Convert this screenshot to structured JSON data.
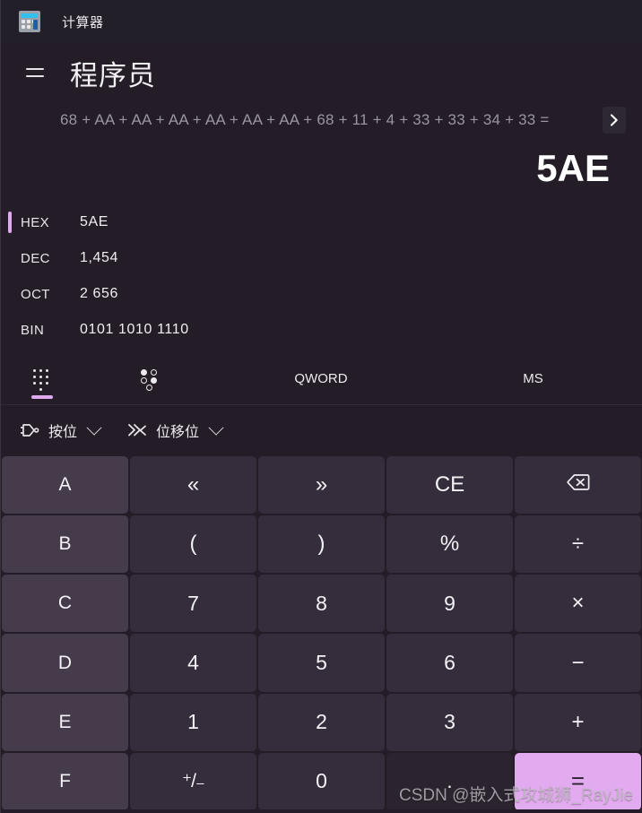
{
  "window": {
    "app_name": "计算器",
    "app_icon": "calculator-icon"
  },
  "header": {
    "menu_icon": "hamburger-menu-icon",
    "mode_title": "程序员"
  },
  "display": {
    "expression": "68 + AA + AA + AA + AA + AA + AA + 68 + 11 + 4 + 33 + 33 + 34 + 33 =",
    "scroll_right_icon": "chevron-right-icon",
    "result": "5AE"
  },
  "radix": {
    "active": "HEX",
    "rows": [
      {
        "label": "HEX",
        "value": "5AE"
      },
      {
        "label": "DEC",
        "value": "1,454"
      },
      {
        "label": "OCT",
        "value": "2 656"
      },
      {
        "label": "BIN",
        "value": "0101 1010 1110"
      }
    ]
  },
  "tabs": [
    {
      "label": "",
      "icon": "keypad-dots-icon",
      "active": true
    },
    {
      "label": "",
      "icon": "bit-toggle-icon",
      "active": false
    },
    {
      "label": "QWORD",
      "icon": "",
      "active": false
    },
    {
      "label": "MS",
      "icon": "",
      "active": false
    }
  ],
  "functions": [
    {
      "label": "按位",
      "icon": "logic-gate-icon",
      "chevron": "chevron-down-icon"
    },
    {
      "label": "位移位",
      "icon": "bit-shift-icon",
      "chevron": "chevron-down-icon"
    }
  ],
  "keypad": {
    "keys": [
      {
        "label": "A",
        "name": "key-a",
        "style": "hexkey"
      },
      {
        "label": "«",
        "name": "key-shift-left",
        "style": "op"
      },
      {
        "label": "»",
        "name": "key-shift-right",
        "style": "op"
      },
      {
        "label": "CE",
        "name": "key-clear-entry",
        "style": "op"
      },
      {
        "label": "",
        "name": "key-backspace",
        "style": "op",
        "icon": "backspace-icon"
      },
      {
        "label": "B",
        "name": "key-b",
        "style": "hexkey"
      },
      {
        "label": "(",
        "name": "key-paren-open",
        "style": "op"
      },
      {
        "label": ")",
        "name": "key-paren-close",
        "style": "op"
      },
      {
        "label": "%",
        "name": "key-percent",
        "style": "op"
      },
      {
        "label": "÷",
        "name": "key-divide",
        "style": "op"
      },
      {
        "label": "C",
        "name": "key-c",
        "style": "hexkey"
      },
      {
        "label": "7",
        "name": "key-7",
        "style": ""
      },
      {
        "label": "8",
        "name": "key-8",
        "style": ""
      },
      {
        "label": "9",
        "name": "key-9",
        "style": ""
      },
      {
        "label": "×",
        "name": "key-multiply",
        "style": "op"
      },
      {
        "label": "D",
        "name": "key-d",
        "style": "hexkey"
      },
      {
        "label": "4",
        "name": "key-4",
        "style": ""
      },
      {
        "label": "5",
        "name": "key-5",
        "style": ""
      },
      {
        "label": "6",
        "name": "key-6",
        "style": ""
      },
      {
        "label": "−",
        "name": "key-subtract",
        "style": "op"
      },
      {
        "label": "E",
        "name": "key-e",
        "style": "hexkey"
      },
      {
        "label": "1",
        "name": "key-1",
        "style": ""
      },
      {
        "label": "2",
        "name": "key-2",
        "style": ""
      },
      {
        "label": "3",
        "name": "key-3",
        "style": ""
      },
      {
        "label": "+",
        "name": "key-add",
        "style": "op"
      },
      {
        "label": "F",
        "name": "key-f",
        "style": "hexkey"
      },
      {
        "label": "⁺/₋",
        "name": "key-plus-minus",
        "style": "pm"
      },
      {
        "label": "0",
        "name": "key-0",
        "style": ""
      },
      {
        "label": ".",
        "name": "key-decimal",
        "style": "dim"
      },
      {
        "label": "=",
        "name": "key-equals",
        "style": "equals"
      }
    ]
  },
  "watermark": {
    "text": "CSDN @嵌入式攻城狮_RayJie"
  },
  "colors": {
    "accent": "#e0aaee",
    "background": "#241d27",
    "titlebar": "#231f28",
    "key": "#352d3b",
    "hex_key": "#453b4b",
    "equals": "#e3abef"
  }
}
